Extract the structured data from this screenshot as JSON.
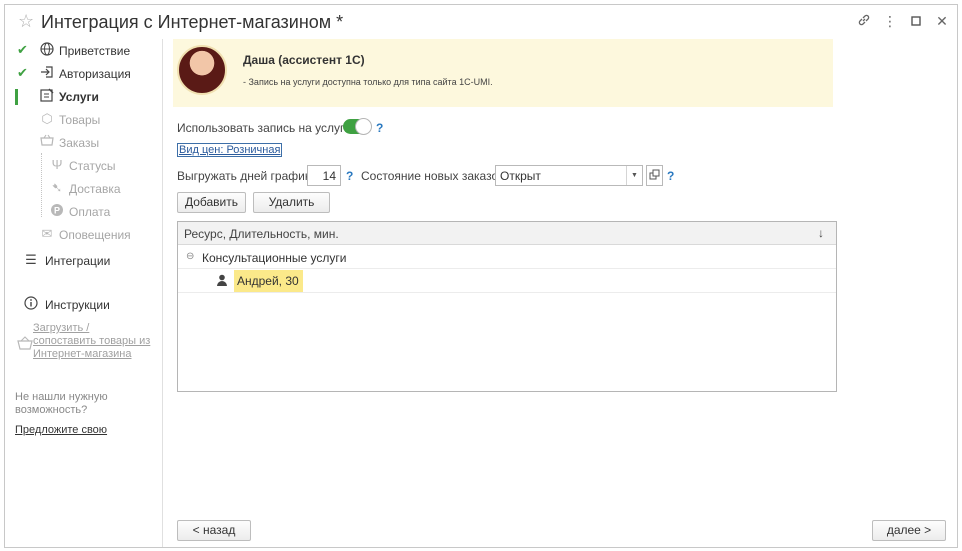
{
  "window": {
    "title": "Интеграция с Интернет-магазином *"
  },
  "titlebar_icons": {
    "favorite": "star-icon",
    "link": "link-icon",
    "more": "more-vertical-icon",
    "maximize": "maximize-icon",
    "close": "close-icon"
  },
  "sidebar": {
    "items": [
      {
        "label": "Приветствие",
        "icon": "globe-icon",
        "state": "done"
      },
      {
        "label": "Авторизация",
        "icon": "login-icon",
        "state": "done"
      },
      {
        "label": "Услуги",
        "icon": "services-icon",
        "state": "active"
      },
      {
        "label": "Товары",
        "icon": "box-icon",
        "state": "disabled"
      },
      {
        "label": "Заказы",
        "icon": "cart-icon",
        "state": "disabled"
      },
      {
        "label": "Статусы",
        "icon": "status-icon",
        "state": "disabled"
      },
      {
        "label": "Доставка",
        "icon": "truck-icon",
        "state": "disabled"
      },
      {
        "label": "Оплата",
        "icon": "payment-icon",
        "state": "disabled"
      },
      {
        "label": "Оповещения",
        "icon": "envelope-icon",
        "state": "disabled"
      },
      {
        "label": "Интеграции",
        "icon": "menu-icon",
        "state": "normal"
      }
    ],
    "instructions": "Инструкции",
    "load_link": "Загрузить / сопоставить товары из Интернет-магазина",
    "load_link_lines": [
      "Загрузить /",
      "сопоставить товары из",
      "Интернет-магазина"
    ],
    "not_found_lines": [
      "Не нашли нужную",
      "возможность?"
    ],
    "suggest_link": "Предложите свою"
  },
  "assistant": {
    "name": "Даша (ассистент 1С)",
    "message": "- Запись на услуги доступна только для типа сайта 1С-UMI."
  },
  "form": {
    "use_booking_label": "Использовать запись на услуги:",
    "use_booking_value": true,
    "help_mark": "?",
    "price_type_link": "Вид цен: Розничная",
    "days_label": "Выгружать дней графика:",
    "days_value": "14",
    "order_state_label": "Состояние новых заказов:",
    "order_state_value": "Открыт",
    "add_button": "Добавить",
    "delete_button": "Удалить"
  },
  "grid": {
    "column_header": "Ресурс, Длительность, мин.",
    "sort_indicator": "↓",
    "group_row": "Консультационные услуги",
    "item_row": "Андрей, 30"
  },
  "footer": {
    "back_button": "< назад",
    "next_button": "далее >"
  },
  "colors": {
    "accent_green": "#3fa142",
    "assistant_bg": "#fdf8dd",
    "highlight_yellow": "#fbe98a",
    "help_blue": "#2a79c0"
  }
}
